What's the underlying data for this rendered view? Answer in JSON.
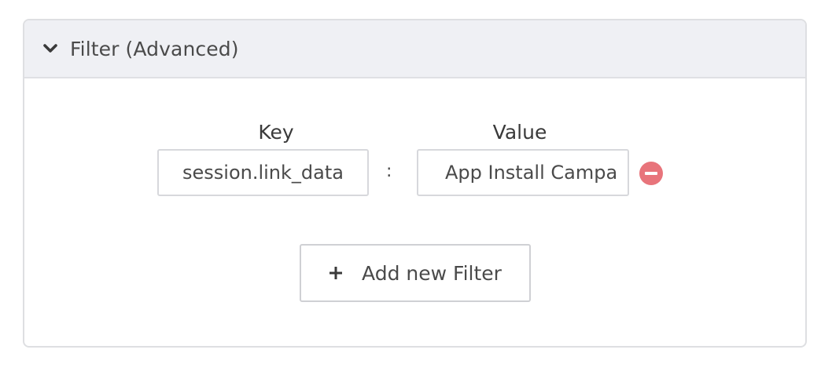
{
  "panel": {
    "title": "Filter (Advanced)",
    "expanded": true,
    "toggle_icon": "chevron-down-icon"
  },
  "filter": {
    "key_label": "Key",
    "value_label": "Value",
    "separator": ":",
    "rows": [
      {
        "key": "session.link_data",
        "value": "App Install Campa",
        "remove_icon": "minus-circle-icon",
        "remove_color": "#e8747b"
      }
    ]
  },
  "add_button": {
    "icon": "plus-icon",
    "label": "Add new Filter"
  },
  "colors": {
    "header_bg": "#eff0f4",
    "border": "#dedfe2",
    "text": "#4a4a4a"
  }
}
